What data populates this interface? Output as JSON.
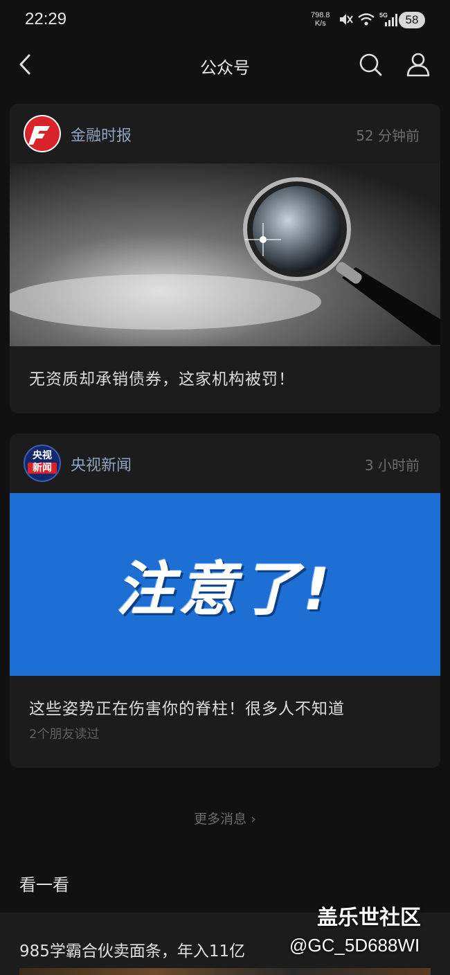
{
  "status_bar": {
    "time": "22:29",
    "net_speed_value": "798.8",
    "net_speed_unit": "K/s",
    "battery": "58",
    "icons": [
      "mute-icon",
      "wifi-icon",
      "signal-5g-icon"
    ]
  },
  "nav": {
    "title": "公众号",
    "icons": [
      "back-icon",
      "search-icon",
      "user-icon"
    ]
  },
  "cards": [
    {
      "source": "金融时报",
      "time_ago": "52 分钟前",
      "title": "无资质却承销债券，这家机构被罚！",
      "cover": "magnifying-glass-image"
    },
    {
      "source": "央视新闻",
      "avatar_text_top": "央视",
      "avatar_text_bottom": "新闻",
      "time_ago": "3 小时前",
      "cover_text": "注意了!",
      "cover_color": "#1e6fd4",
      "title": "这些姿势正在伤害你的脊柱！很多人不知道",
      "friends_read": "2个朋友读过"
    }
  ],
  "more_messages": "更多消息 ›",
  "section_title": "看一看",
  "feed_article_title": "985学霸合伙卖面条，年入11亿",
  "watermark": "盖乐世社区",
  "watermark_handle": "@GC_5D688WI",
  "colors": {
    "background": "#111111",
    "card": "#1c1c1c",
    "source_name": "#8ea3c0",
    "accent_blue": "#1e6fd4"
  }
}
